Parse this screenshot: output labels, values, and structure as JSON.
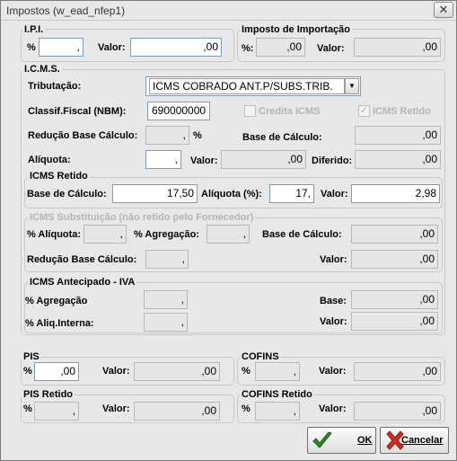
{
  "window": {
    "title": "Impostos (w_ead_nfep1)",
    "close_symbol": "✕"
  },
  "ipi": {
    "title": "I.P.I.",
    "pct_label": "%",
    "pct_value": ",",
    "valor_label": "Valor:",
    "valor_value": ",00"
  },
  "importacao": {
    "title": "Imposto de Importação",
    "pct_label": "%:",
    "pct_value": ",00",
    "valor_label": "Valor:",
    "valor_value": ",00"
  },
  "icms": {
    "title": "I.C.M.S.",
    "tributacao_label": "Tributação:",
    "tributacao_value": "ICMS COBRADO ANT.P/SUBS.TRIB.",
    "classif_label": "Classif.Fiscal (NBM):",
    "classif_value": "690000000",
    "credita_label": "Credita ICMS",
    "credita_checked": false,
    "retido_chk_label": "ICMS Retido",
    "retido_checked": true,
    "reducao_label": "Redução Base Cálculo:",
    "reducao_value": ",",
    "reducao_pct": "%",
    "base_label": "Base de Cálculo:",
    "base_value": ",00",
    "aliquota_label": "Alíquota:",
    "aliquota_value": ",",
    "valor_label": "Valor:",
    "valor_value": ",00",
    "diferido_label": "Diferido:",
    "diferido_value": ",00"
  },
  "icms_retido": {
    "title": "ICMS Retido",
    "base_label": "Base de Cálculo:",
    "base_value": "17,50",
    "aliquota_label": "Alíquota (%):",
    "aliquota_value": "17,",
    "valor_label": "Valor:",
    "valor_value": "2,98"
  },
  "icms_subst": {
    "title": "ICMS Substituição (não retido pelo Fornecedor)",
    "aliquota_label": "% Alíquota:",
    "aliquota_value": ",",
    "agregacao_label": "% Agregação:",
    "agregacao_value": ",",
    "base_label": "Base de Cálculo:",
    "base_value": ",00",
    "reducao_label": "Redução Base Cálculo:",
    "reducao_value": ",",
    "valor_label": "Valor:",
    "valor_value": ",00"
  },
  "icms_antecipado": {
    "title": "ICMS Antecipado - IVA",
    "agregacao_label": "% Agregação",
    "agregacao_value": ",",
    "base_label": "Base:",
    "base_value": ",00",
    "aliq_label": "% Aliq.Interna:",
    "aliq_value": ",",
    "valor_label": "Valor:",
    "valor_value": ",00"
  },
  "pis": {
    "title": "PIS",
    "pct_label": "%",
    "pct_value": ",00",
    "valor_label": "Valor:",
    "valor_value": ",00"
  },
  "cofins": {
    "title": "COFINS",
    "pct_label": "%",
    "pct_value": ",",
    "valor_label": "Valor:",
    "valor_value": ",00"
  },
  "pis_retido": {
    "title": "PIS Retido",
    "pct_label": "%",
    "pct_value": ",",
    "valor_label": "Valor:",
    "valor_value": ",00"
  },
  "cofins_retido": {
    "title": "COFINS Retido",
    "pct_label": "%",
    "pct_value": ",",
    "valor_label": "Valor:",
    "valor_value": ",00"
  },
  "buttons": {
    "ok_label": "OK",
    "cancel_label": "Cancelar",
    "ok_icon": "checkmark-icon",
    "cancel_icon": "x-mark-icon"
  },
  "colors": {
    "ok_icon": "#2e8b22",
    "cancel_icon": "#d62a1e"
  }
}
